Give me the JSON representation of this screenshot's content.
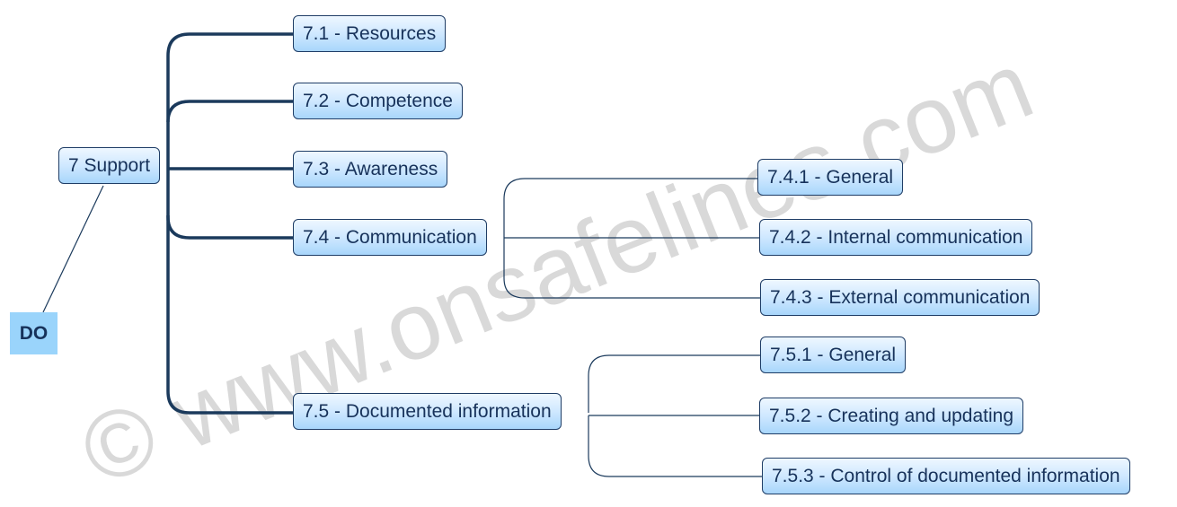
{
  "watermark": "© www.onsafelines.com",
  "root": {
    "label": "7 Support",
    "tag": "DO"
  },
  "children": [
    {
      "label": "7.1 - Resources"
    },
    {
      "label": "7.2 - Competence"
    },
    {
      "label": "7.3 - Awareness"
    },
    {
      "label": "7.4 - Communication",
      "children": [
        {
          "label": "7.4.1 - General"
        },
        {
          "label": "7.4.2 - Internal communication"
        },
        {
          "label": "7.4.3 - External communication"
        }
      ]
    },
    {
      "label": "7.5 - Documented information",
      "children": [
        {
          "label": "7.5.1 - General"
        },
        {
          "label": "7.5.2 - Creating and updating"
        },
        {
          "label": "7.5.3 - Control of documented information"
        }
      ]
    }
  ],
  "colors": {
    "connector": "#1b3a5c",
    "node_border": "#1f3d66",
    "tag_fill": "#9ad4fb",
    "watermark": "#d3d3d3"
  }
}
